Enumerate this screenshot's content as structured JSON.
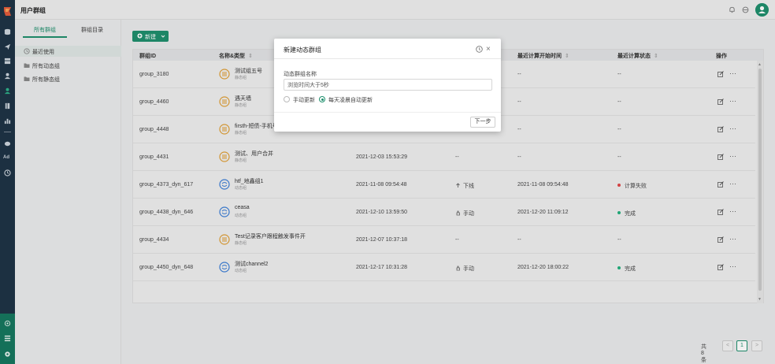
{
  "app": {
    "title": "用户群组"
  },
  "left_panel": {
    "tabs": [
      {
        "label": "所有群组"
      },
      {
        "label": "群组目录"
      }
    ],
    "items": [
      {
        "label": "最近使用"
      },
      {
        "label": "所有动态组"
      },
      {
        "label": "所有静态组"
      }
    ]
  },
  "toolbar": {
    "new_label": "新建"
  },
  "table": {
    "headers": {
      "id": "群组ID",
      "name_type": "名称&类型",
      "last_calc_time": "最近计算开始时间",
      "last_calc_status": "最近计算状态",
      "ops": "操作"
    },
    "rows": [
      {
        "id": "group_3180",
        "name": "测试组五号",
        "type": "静态组",
        "created": "",
        "mode": "",
        "last_time": "--",
        "status": "--",
        "kind": "static"
      },
      {
        "id": "group_4460",
        "name": "遇天墙",
        "type": "静态组",
        "created": "",
        "mode": "",
        "last_time": "--",
        "status": "--",
        "kind": "static"
      },
      {
        "id": "group_4448",
        "name": "firsth-短债-手机号",
        "type": "静态组",
        "created": "",
        "mode": "",
        "last_time": "--",
        "status": "--",
        "kind": "static"
      },
      {
        "id": "group_4431",
        "name": "测试、用户合并",
        "type": "静态组",
        "created": "2021-12-03 15:53:29",
        "mode": "--",
        "last_time": "--",
        "status": "--",
        "kind": "static"
      },
      {
        "id": "group_4373_dyn_617",
        "name": "htf_地鑫组1",
        "type": "动态组",
        "created": "2021-11-08 09:54:48",
        "mode": "下线",
        "last_time": "2021-11-08 09:54:48",
        "status": "计算失败",
        "kind": "dynamic",
        "mode_icon": "arrow-up",
        "status_color": "#e04848"
      },
      {
        "id": "group_4438_dyn_646",
        "name": "ceasa",
        "type": "动态组",
        "created": "2021-12-10 13:59:50",
        "mode": "手动",
        "last_time": "2021-12-20 11:09:12",
        "status": "完成",
        "kind": "dynamic",
        "mode_icon": "hand",
        "status_color": "#22b07d"
      },
      {
        "id": "group_4434",
        "name": "Test记录客户跟程触发事件开",
        "type": "静态组",
        "created": "2021-12-07 10:37:18",
        "mode": "--",
        "last_time": "--",
        "status": "--",
        "kind": "static"
      },
      {
        "id": "group_4450_dyn_648",
        "name": "测试channel2",
        "type": "动态组",
        "created": "2021-12-17 10:31:28",
        "mode": "手动",
        "last_time": "2021-12-20 18:00:22",
        "status": "完成",
        "kind": "dynamic",
        "mode_icon": "hand",
        "status_color": "#22b07d"
      }
    ]
  },
  "pagination": {
    "total": "共 8 条",
    "current": "1",
    "prev": "<",
    "next": ">"
  },
  "modal": {
    "title": "新建动态群组",
    "field_label": "动态群组名称",
    "field_value": "浏览时间大于5秒",
    "radio_manual": "手动更新",
    "radio_daily": "每天凌晨自动更新",
    "next_label": "下一步",
    "close": "×"
  },
  "colors": {
    "accent": "#1f8f6d",
    "rail": "#1e3346",
    "static_icon": "#e0a038",
    "dynamic_icon": "#3d7fd6"
  }
}
